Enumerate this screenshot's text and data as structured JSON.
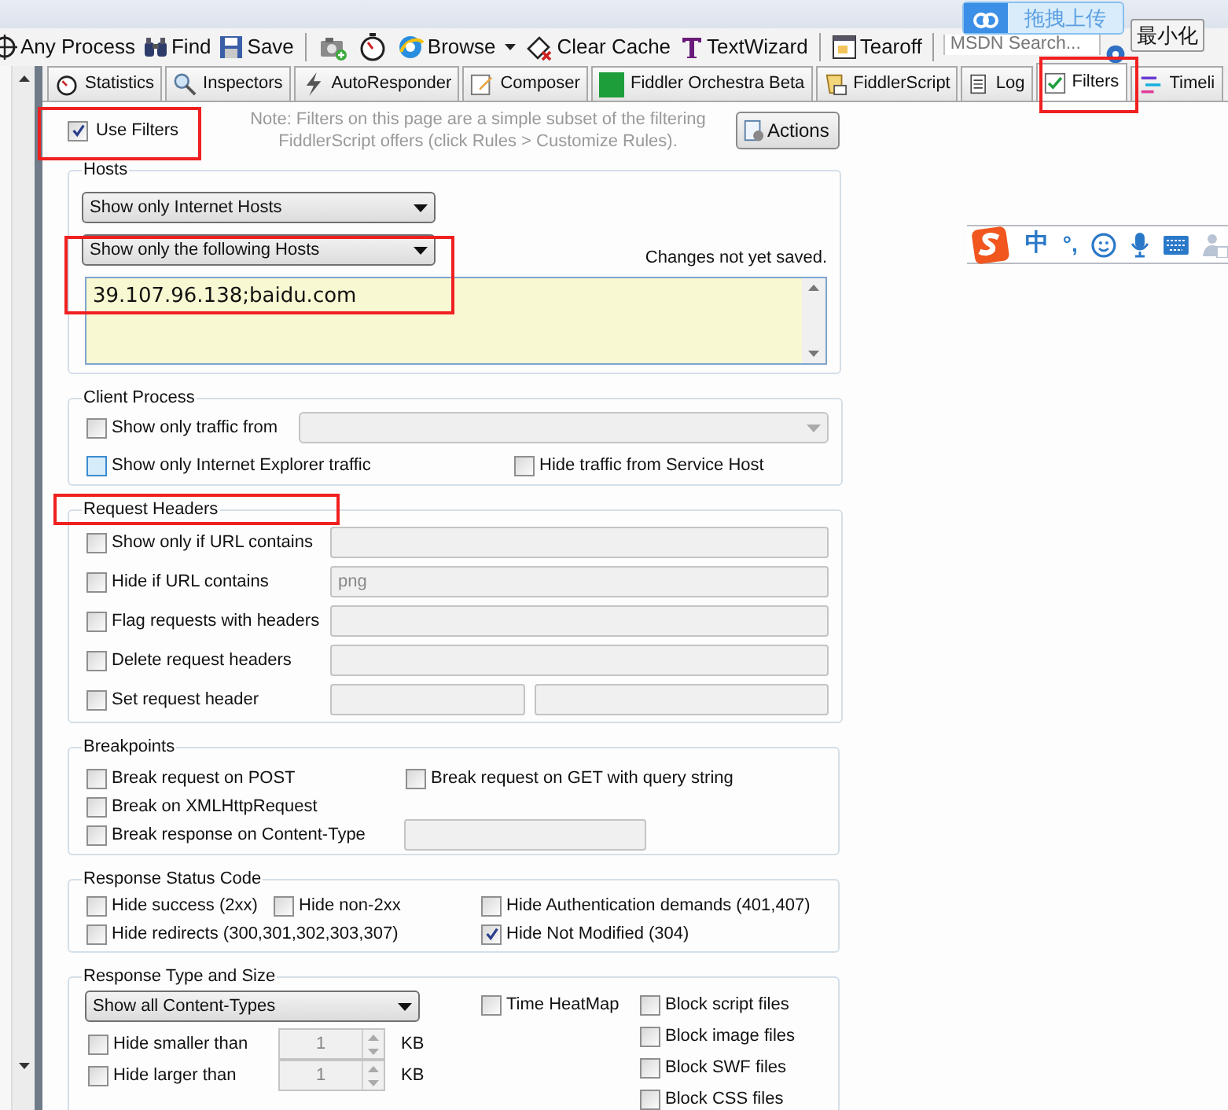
{
  "overlay": {
    "upload_button": "拖拽上传",
    "minimize_button": "最小化"
  },
  "toolbar": [
    {
      "kind": "button",
      "label": "Any Process"
    },
    {
      "kind": "button",
      "label": "Find"
    },
    {
      "kind": "button",
      "label": "Save"
    },
    {
      "kind": "separator"
    },
    {
      "kind": "icon_button"
    },
    {
      "kind": "icon_button"
    },
    {
      "kind": "button",
      "label": "Browse"
    },
    {
      "kind": "menu_arrow"
    },
    {
      "kind": "button",
      "label": "Clear Cache"
    },
    {
      "kind": "button",
      "label": "TextWizard"
    },
    {
      "kind": "separator"
    },
    {
      "kind": "button",
      "label": "Tearoff"
    },
    {
      "kind": "separator"
    }
  ],
  "search": {
    "placeholder": "MSDN Search..."
  },
  "tabs": [
    {
      "label": "Statistics",
      "selected": false
    },
    {
      "label": "Inspectors",
      "selected": false
    },
    {
      "label": "AutoResponder",
      "selected": false
    },
    {
      "label": "Composer",
      "selected": false
    },
    {
      "label": "Fiddler Orchestra Beta",
      "selected": false
    },
    {
      "label": "FiddlerScript",
      "selected": false
    },
    {
      "label": "Log",
      "selected": false
    },
    {
      "label": "Filters",
      "selected": true
    },
    {
      "label": "Timeli",
      "selected": false
    }
  ],
  "use_filters": {
    "label": "Use Filters",
    "checked": true
  },
  "note": "Note: Filters on this page are a simple subset of the filtering FiddlerScript offers (click Rules > Customize Rules).",
  "actions_button": "Actions",
  "hosts": {
    "title": "Hosts",
    "zone_filter": "Show only Internet Hosts",
    "host_filter": "Show only the following Hosts",
    "status": "Changes not yet saved.",
    "host_list": "39.107.96.138;baidu.com"
  },
  "client_process": {
    "title": "Client Process",
    "items": [
      {
        "label": "Show only traffic from",
        "checked": false,
        "focused": false
      },
      {
        "label": "Show only Internet Explorer traffic",
        "checked": false,
        "focused": true
      },
      {
        "label": "Hide traffic from Service Host",
        "checked": false,
        "focused": false
      }
    ]
  },
  "request_headers": {
    "title": "Request Headers",
    "rows": [
      {
        "kind": "single_field",
        "label": "Show only if URL contains",
        "checked": false
      },
      {
        "kind": "single_field",
        "label": "Hide if URL contains",
        "checked": false,
        "value": "png"
      },
      {
        "kind": "single_field",
        "label": "Flag requests with headers",
        "checked": false
      },
      {
        "kind": "single_field",
        "label": "Delete request headers",
        "checked": false
      },
      {
        "kind": "double_field",
        "label": "Set request header",
        "checked": false
      }
    ]
  },
  "breakpoints": {
    "title": "Breakpoints",
    "items": [
      {
        "label": "Break request on POST",
        "checked": false
      },
      {
        "label": "Break request on GET with query string",
        "checked": false
      },
      {
        "label": "Break on XMLHttpRequest",
        "checked": false
      },
      {
        "label": "Break response on Content-Type",
        "checked": false
      }
    ]
  },
  "response_status": {
    "title": "Response Status Code",
    "items": [
      {
        "label": "Hide success (2xx)",
        "checked": false
      },
      {
        "label": "Hide non-2xx",
        "checked": false
      },
      {
        "label": "Hide Authentication demands (401,407)",
        "checked": false
      },
      {
        "label": "Hide redirects (300,301,302,303,307)",
        "checked": false
      },
      {
        "label": "Hide Not Modified (304)",
        "checked": true
      }
    ]
  },
  "response_type": {
    "title": "Response Type and Size",
    "content_types": "Show all Content-Types",
    "size_rows": [
      {
        "label": "Hide smaller than",
        "checked": false,
        "value": "1",
        "unit": "KB"
      },
      {
        "label": "Hide larger than",
        "checked": false,
        "value": "1",
        "unit": "KB"
      }
    ],
    "time_heatmap": {
      "label": "Time HeatMap",
      "checked": false
    },
    "block_items": [
      {
        "label": "Block script files",
        "checked": false
      },
      {
        "label": "Block image files",
        "checked": false
      },
      {
        "label": "Block SWF files",
        "checked": false
      },
      {
        "label": "Block CSS files",
        "checked": false
      }
    ]
  },
  "ime_bar": {
    "mode": "中",
    "punctuation": "°,"
  }
}
